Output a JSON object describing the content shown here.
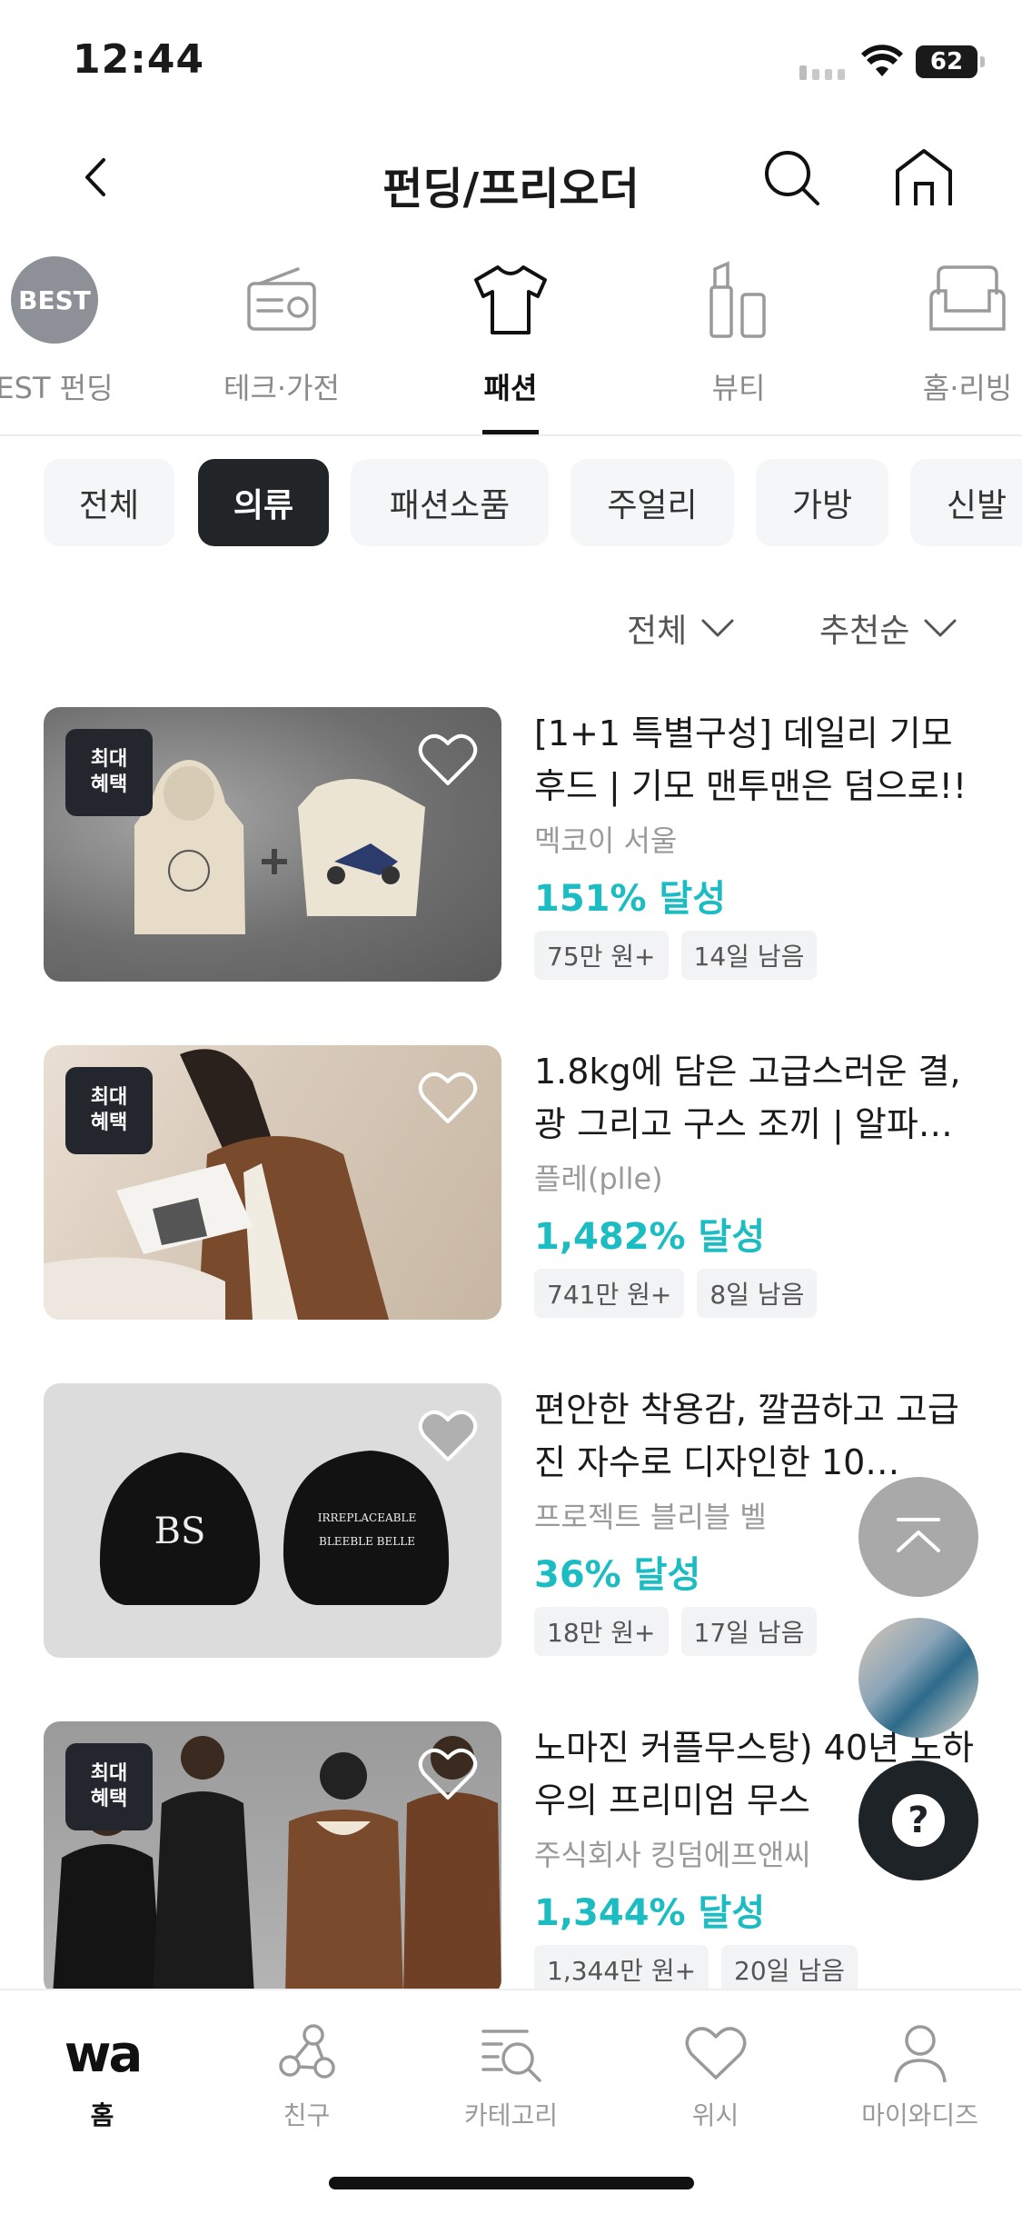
{
  "status_bar": {
    "time": "12:44",
    "battery": "62"
  },
  "header": {
    "title": "펀딩/프리오더"
  },
  "categories": [
    {
      "label": "EST 펀딩",
      "icon": "best-badge-icon",
      "badge": "BEST"
    },
    {
      "label": "테크·가전",
      "icon": "radio-icon"
    },
    {
      "label": "패션",
      "icon": "tshirt-icon",
      "active": true
    },
    {
      "label": "뷰티",
      "icon": "lipstick-icon"
    },
    {
      "label": "홈·리빙",
      "icon": "sofa-icon"
    }
  ],
  "chips": [
    {
      "label": "전체"
    },
    {
      "label": "의류",
      "active": true
    },
    {
      "label": "패션소품"
    },
    {
      "label": "주얼리"
    },
    {
      "label": "가방"
    },
    {
      "label": "신발"
    }
  ],
  "filters": {
    "scope": "전체",
    "sort": "추천순"
  },
  "products": [
    {
      "badge": "최대\n혜택",
      "title": "[1+1 특별구성] 데일리 기모 후드 | 기모 맨투맨은 덤으로!!",
      "seller": "멕코이 서울",
      "rate": "151% 달성",
      "amount": "75만 원+",
      "remaining": "14일 남음"
    },
    {
      "badge": "최대\n혜택",
      "title": "1.8kg에 담은 고급스러운 결, 광 그리고 구스 조끼 | 알파…",
      "seller": "플레(plle)",
      "rate": "1,482% 달성",
      "amount": "741만 원+",
      "remaining": "8일 남음"
    },
    {
      "badge": "",
      "title": "편안한 착용감, 깔끔하고 고급진 자수로 디자인한 10…",
      "seller": "프로젝트 블리블 벨",
      "rate": "36% 달성",
      "amount": "18만 원+",
      "remaining": "17일 남음"
    },
    {
      "badge": "최대\n혜택",
      "title": "노마진 커플무스탕) 40년 노하우의 프리미엄 무스",
      "seller": "주식회사 킹덤에프앤씨",
      "rate": "1,344% 달성",
      "amount": "1,344만 원+",
      "remaining": "20일 남음"
    }
  ],
  "cap_texts": {
    "left": "BS",
    "right_line1": "IRREPLACEABLE",
    "right_line2": "BLEEBLE BELLE"
  },
  "floating": {
    "help": "?"
  },
  "tabbar": [
    {
      "label": "홈",
      "icon": "wa-logo-icon",
      "logo": "wa",
      "active": true
    },
    {
      "label": "친구",
      "icon": "friends-icon"
    },
    {
      "label": "카테고리",
      "icon": "category-search-icon"
    },
    {
      "label": "위시",
      "icon": "heart-icon"
    },
    {
      "label": "마이와디즈",
      "icon": "person-icon"
    }
  ],
  "colors": {
    "accent": "#1bbcc2",
    "active_chip": "#222528",
    "badge": "#23272d"
  }
}
